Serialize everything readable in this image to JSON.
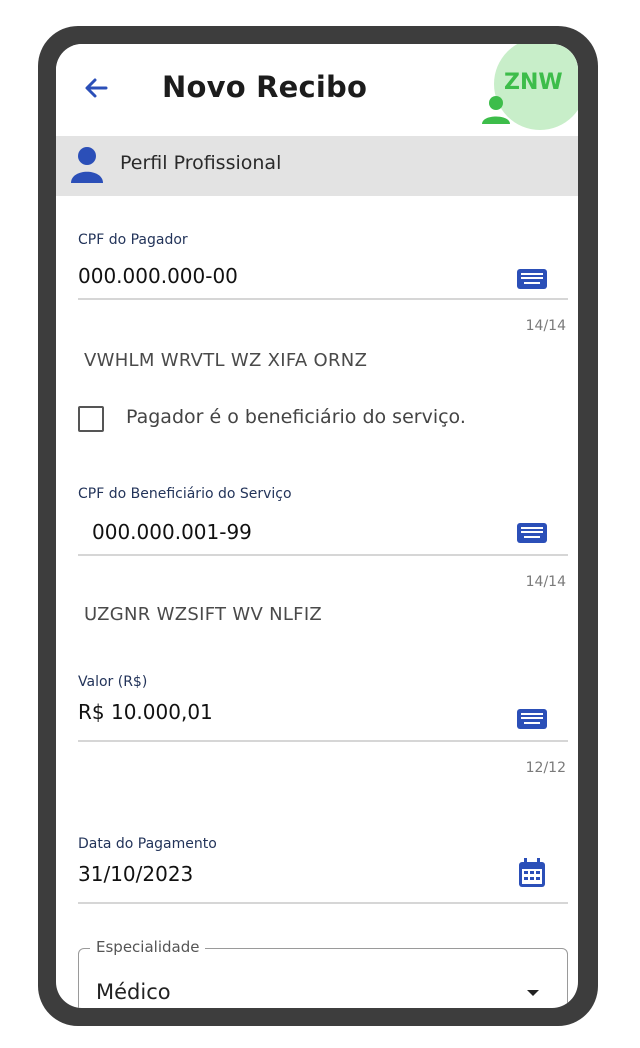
{
  "header": {
    "title": "Novo Recibo",
    "avatar_text": "ZNW"
  },
  "profile": {
    "label": "Perfil Profissional"
  },
  "payer": {
    "label": "CPF do Pagador",
    "value": "000.000.000-00",
    "counter": "14/14",
    "name": "VWHLM WRVTL WZ XIFA ORNZ"
  },
  "checkbox": {
    "label": "Pagador é o beneficiário do serviço.",
    "checked": false
  },
  "beneficiary": {
    "label": "CPF do Beneficiário do Serviço",
    "value": "000.000.001-99",
    "counter": "14/14",
    "name": "UZGNR WZSIFT WV NLFIZ"
  },
  "amount": {
    "label": "Valor (R$)",
    "value": "R$ 10.000,01",
    "counter": "12/12"
  },
  "payment_date": {
    "label": "Data do Pagamento",
    "value": "31/10/2023"
  },
  "specialty": {
    "label": "Especialidade",
    "value": "Médico"
  },
  "icons": {
    "back": "arrow-left-icon",
    "avatar": "person-icon",
    "profile": "person-icon",
    "keyboard": "keyboard-icon",
    "calendar": "calendar-icon",
    "dropdown": "caret-down-icon"
  },
  "colors": {
    "accent": "#2b4fb8",
    "avatar_bg": "#c8eec9",
    "avatar_fg": "#3dbd4a",
    "profile_bar": "#e3e3e3",
    "frame": "#3d3d3d"
  }
}
